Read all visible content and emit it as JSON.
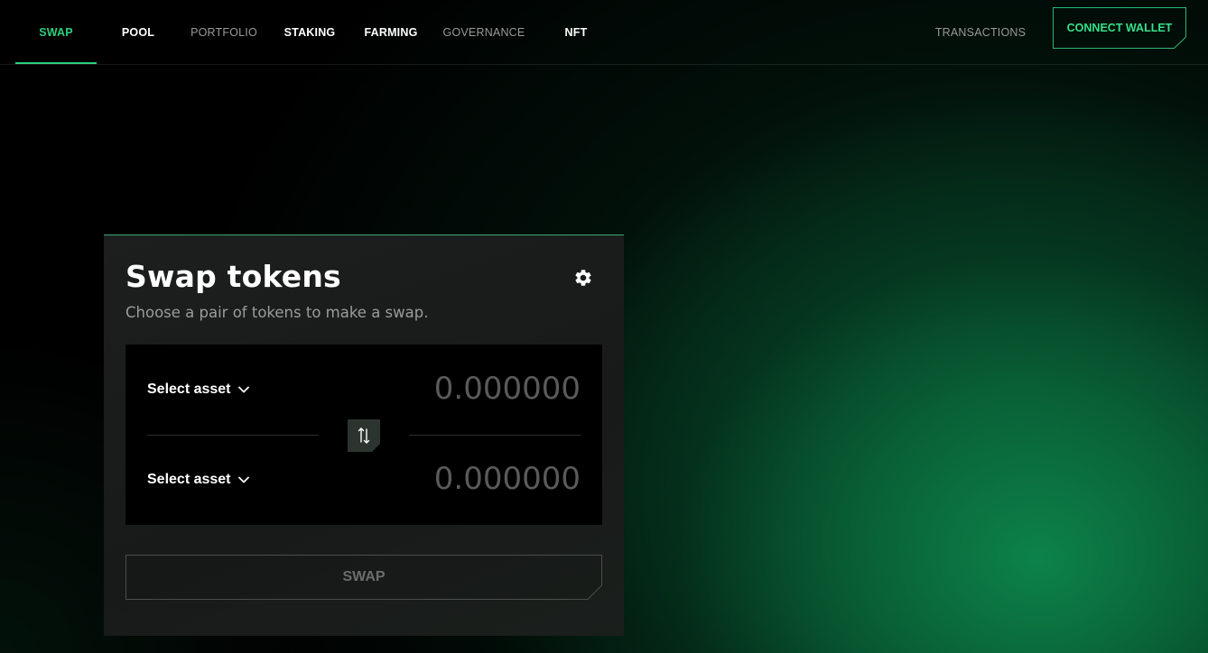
{
  "nav": {
    "items": [
      {
        "label": "SWAP",
        "state": "active"
      },
      {
        "label": "POOL",
        "state": "bright"
      },
      {
        "label": "PORTFOLIO",
        "state": "dim"
      },
      {
        "label": "STAKING",
        "state": "bright"
      },
      {
        "label": "FARMING",
        "state": "bright"
      },
      {
        "label": "GOVERNANCE",
        "state": "dim"
      },
      {
        "label": "NFT",
        "state": "bright"
      }
    ],
    "transactions_label": "TRANSACTIONS",
    "connect_wallet_label": "CONNECT WALLET"
  },
  "colors": {
    "accent": "#2ecf7d",
    "background": "#000000",
    "card": "#1b1d1c"
  },
  "swap_card": {
    "title": "Swap tokens",
    "subtitle": "Choose a pair of tokens to make a swap.",
    "from": {
      "asset_label": "Select asset",
      "amount_placeholder": "0.000000"
    },
    "to": {
      "asset_label": "Select asset",
      "amount_placeholder": "0.000000"
    },
    "swap_button_label": "SWAP",
    "icons": {
      "settings": "gear-icon",
      "flip": "swap-arrows-icon",
      "dropdown": "chevron-down-icon"
    }
  }
}
